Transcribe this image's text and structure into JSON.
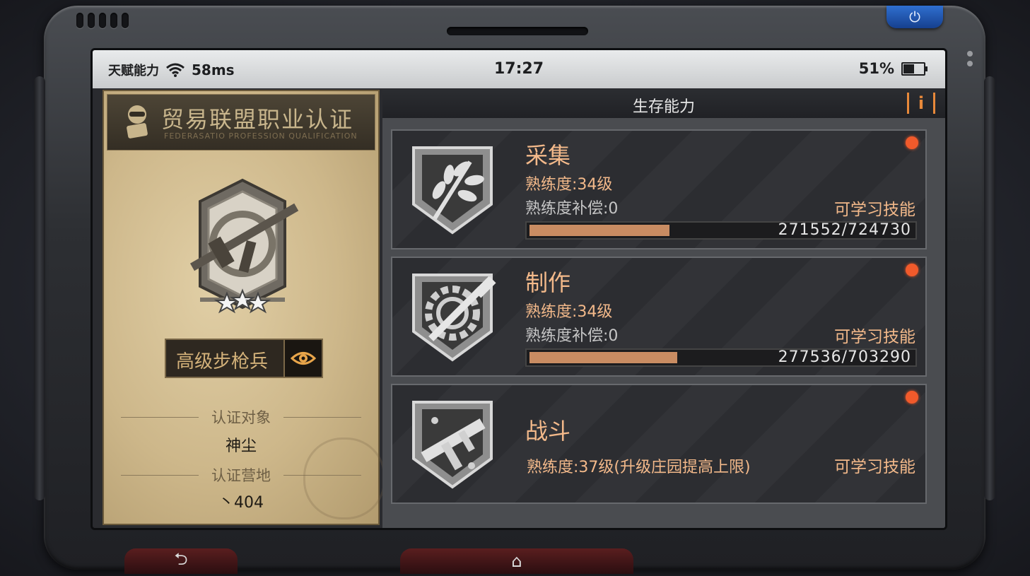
{
  "statusbar": {
    "talent": "天赋能力",
    "ping": "58ms",
    "time": "17:27",
    "battery": "51%"
  },
  "certification": {
    "title": "贸易联盟职业认证",
    "subtitle": "FEDERASATIO PROFESSION QUALIFICATION",
    "stars": 3,
    "rank_name": "高级步枪兵",
    "target_label": "认证对象",
    "target_value": "神尘",
    "camp_label": "认证营地",
    "camp_value": "丶404"
  },
  "panel": {
    "title": "生存能力",
    "info_glyph": "i"
  },
  "skills": [
    {
      "name": "采集",
      "proficiency": "熟练度:34级",
      "compensation": "熟练度补偿:0",
      "learn": "可学习技能",
      "progress_text": "271552/724730",
      "progress": 0.3747,
      "icon": "herb-icon",
      "has_notice": true
    },
    {
      "name": "制作",
      "proficiency": "熟练度:34级",
      "compensation": "熟练度补偿:0",
      "learn": "可学习技能",
      "progress_text": "277536/703290",
      "progress": 0.3946,
      "icon": "gear-hammer-icon",
      "has_notice": true
    },
    {
      "name": "战斗",
      "proficiency": "熟练度:37级(升级庄园提高上限)",
      "learn": "可学习技能",
      "icon": "smg-icon",
      "has_notice": true
    }
  ],
  "nav": {
    "back_glyph": "⮌",
    "home_glyph": "⌂",
    "power_glyph": "⏻"
  },
  "colors": {
    "accent_orange": "#f3b98a",
    "notice_red": "#f15a2b",
    "progress_fill": "#c98c62",
    "info_orange": "#e8893a"
  }
}
